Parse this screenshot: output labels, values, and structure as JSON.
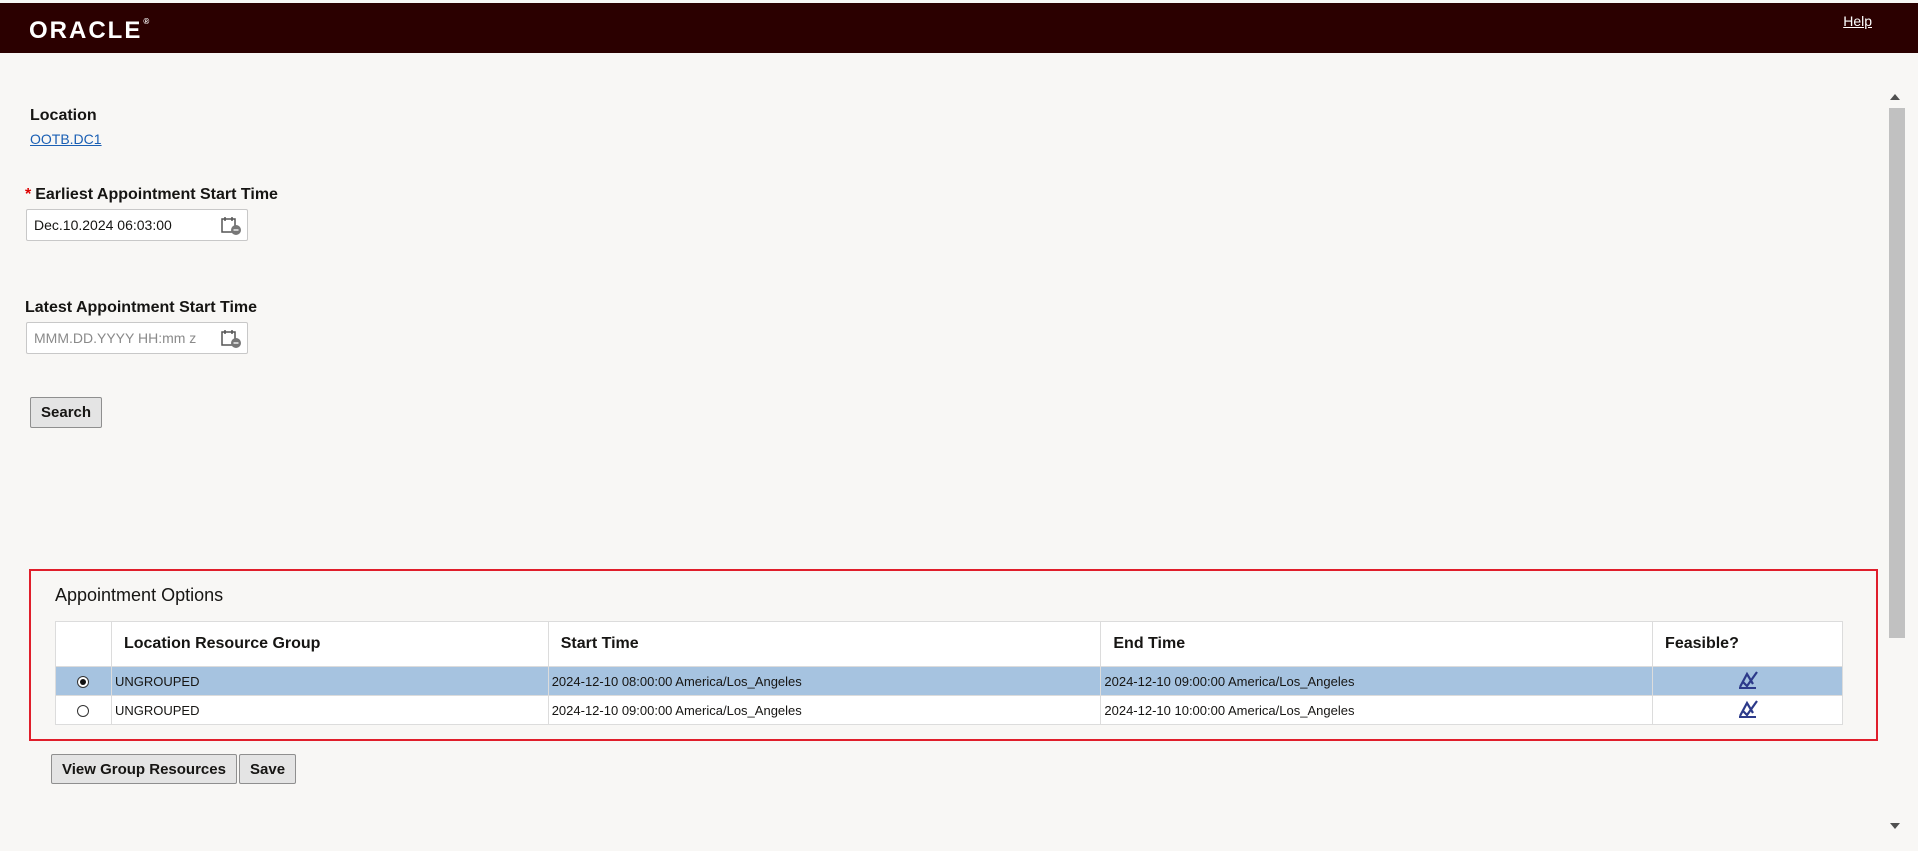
{
  "header": {
    "logo": "ORACLE",
    "help_label": "Help"
  },
  "location": {
    "label": "Location",
    "value": "OOTB.DC1"
  },
  "earliest": {
    "required_mark": "*",
    "label": "Earliest Appointment Start Time",
    "value": "Dec.10.2024 06:03:00"
  },
  "latest": {
    "label": "Latest Appointment Start Time",
    "value": "",
    "placeholder": "MMM.DD.YYYY HH:mm z"
  },
  "search_label": "Search",
  "options": {
    "title": "Appointment Options",
    "columns": [
      "Location Resource Group",
      "Start Time",
      "End Time",
      "Feasible?"
    ],
    "rows": [
      {
        "group": "UNGROUPED",
        "start": "2024-12-10 08:00:00 America/Los_Angeles",
        "end": "2024-12-10 09:00:00 America/Los_Angeles",
        "feasible_icon": "feasible-check-icon",
        "selected": true
      },
      {
        "group": "UNGROUPED",
        "start": "2024-12-10 09:00:00 America/Los_Angeles",
        "end": "2024-12-10 10:00:00 America/Los_Angeles",
        "feasible_icon": "feasible-check-icon",
        "selected": false
      }
    ]
  },
  "buttons": {
    "view_group": "View Group Resources",
    "save": "Save"
  },
  "colors": {
    "header_bg": "#2b0000",
    "selected_row": "#a6c3e0",
    "highlight_border": "#e01e2b",
    "link": "#1a5fb4"
  }
}
